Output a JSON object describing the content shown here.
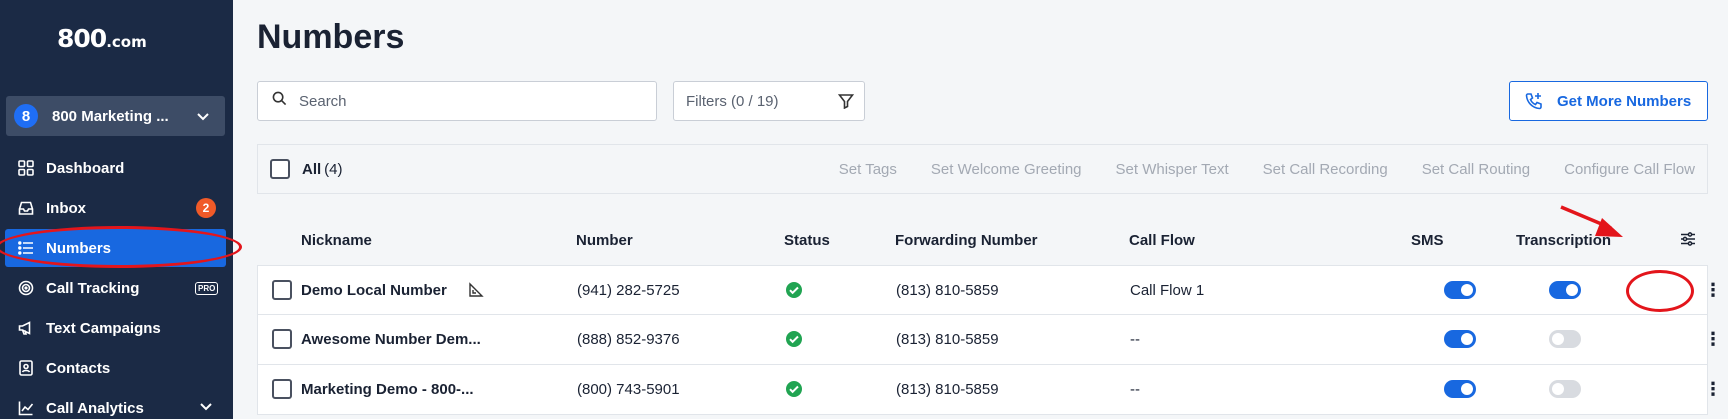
{
  "brand": {
    "logo_text": "800",
    "logo_suffix": ".com"
  },
  "account": {
    "badge": "8",
    "name": "800 Marketing ..."
  },
  "sidebar": {
    "items": [
      {
        "label": "Dashboard",
        "icon": "grid-icon"
      },
      {
        "label": "Inbox",
        "icon": "inbox-icon",
        "badge": "2"
      },
      {
        "label": "Numbers",
        "icon": "list-icon",
        "active": true
      },
      {
        "label": "Call Tracking",
        "icon": "target-icon",
        "badge": "PRO"
      },
      {
        "label": "Text Campaigns",
        "icon": "megaphone-icon"
      },
      {
        "label": "Contacts",
        "icon": "contact-card-icon"
      },
      {
        "label": "Call Analytics",
        "icon": "chart-line-icon"
      }
    ]
  },
  "page": {
    "title": "Numbers"
  },
  "search": {
    "placeholder": "Search"
  },
  "filters": {
    "label": "Filters (0 / 19)"
  },
  "get_more": {
    "label": "Get More Numbers"
  },
  "bulk": {
    "all_label": "All",
    "all_count": "(4)",
    "actions": [
      "Set Tags",
      "Set Welcome Greeting",
      "Set Whisper Text",
      "Set Call Recording",
      "Set Call Routing",
      "Configure Call Flow"
    ]
  },
  "table": {
    "columns": [
      "Nickname",
      "Number",
      "Status",
      "Forwarding Number",
      "Call Flow",
      "SMS",
      "Transcription"
    ],
    "rows": [
      {
        "nickname": "Demo Local Number",
        "number": "(941) 282-5725",
        "status": "active",
        "forwarding": "(813) 810-5859",
        "call_flow": "Call Flow 1",
        "sms": true,
        "transcription": true
      },
      {
        "nickname": "Awesome Number Dem...",
        "number": "(888) 852-9376",
        "status": "active",
        "forwarding": "(813) 810-5859",
        "call_flow": "--",
        "sms": true,
        "transcription": false
      },
      {
        "nickname": "Marketing Demo - 800-...",
        "number": "(800) 743-5901",
        "status": "active",
        "forwarding": "(813) 810-5859",
        "call_flow": "--",
        "sms": true,
        "transcription": false
      }
    ]
  },
  "colors": {
    "sidebar": "#1b2a45",
    "accent": "#1868e0",
    "annotation": "#e3151b",
    "status_ok": "#21a452",
    "badge": "#f05a28"
  }
}
